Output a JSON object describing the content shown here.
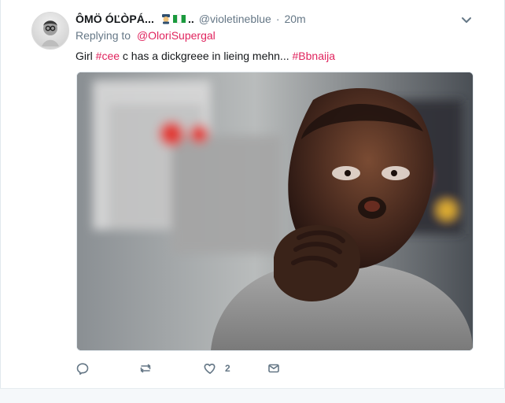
{
  "tweet": {
    "display_name": "ÔMÖ ÓĽÒPÁ...",
    "display_name_suffix": "..",
    "handle": "@violetineblue",
    "separator": "·",
    "time": "20m",
    "replying_label": "Replying to",
    "replying_mention": "@OloriSupergal",
    "text_parts": {
      "p1": "Girl ",
      "h1": "#cee",
      "p2": " c has a dickgreee in lieing mehn... ",
      "h2": "#Bbnaija"
    },
    "actions": {
      "reply_count": "",
      "retweet_count": "",
      "like_count": "2",
      "dm_count": ""
    },
    "icons": {
      "caret": "chevron-down-icon",
      "reply": "reply-icon",
      "retweet": "retweet-icon",
      "like": "heart-icon",
      "dm": "envelope-icon",
      "emoji_1": "police-officer-emoji-icon",
      "emoji_2": "nigeria-flag-emoji-icon"
    },
    "colors": {
      "text": "#14171a",
      "muted": "#657786",
      "link_accent": "#e0245e",
      "border": "#e1e8ed"
    }
  }
}
